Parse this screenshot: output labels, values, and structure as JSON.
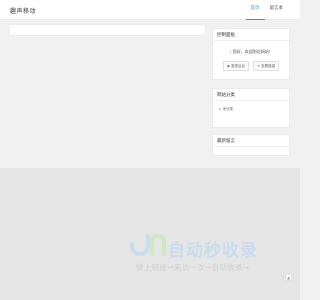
{
  "header": {
    "logo": "趣声移动",
    "nav": [
      {
        "label": "首页",
        "active": true
      },
      {
        "label": "留言本",
        "active": false
      }
    ]
  },
  "sidebar": {
    "panel": {
      "title": "控制面板",
      "welcome": "您好，欢迎到访网站！",
      "login_button": "登录后台",
      "link_button": "查看链接"
    },
    "categories": {
      "title": "网站分类",
      "items": [
        {
          "label": "未分类"
        }
      ]
    },
    "comments": {
      "title": "最新留言"
    }
  },
  "watermark": {
    "brand": "自动秒收录",
    "tagline": "做上链接→来访一次→自动收录→"
  },
  "colors": {
    "accent": "#3a8ee6",
    "watermark_blue": "#c9dcef",
    "watermark_green": "#cfe8c4"
  }
}
